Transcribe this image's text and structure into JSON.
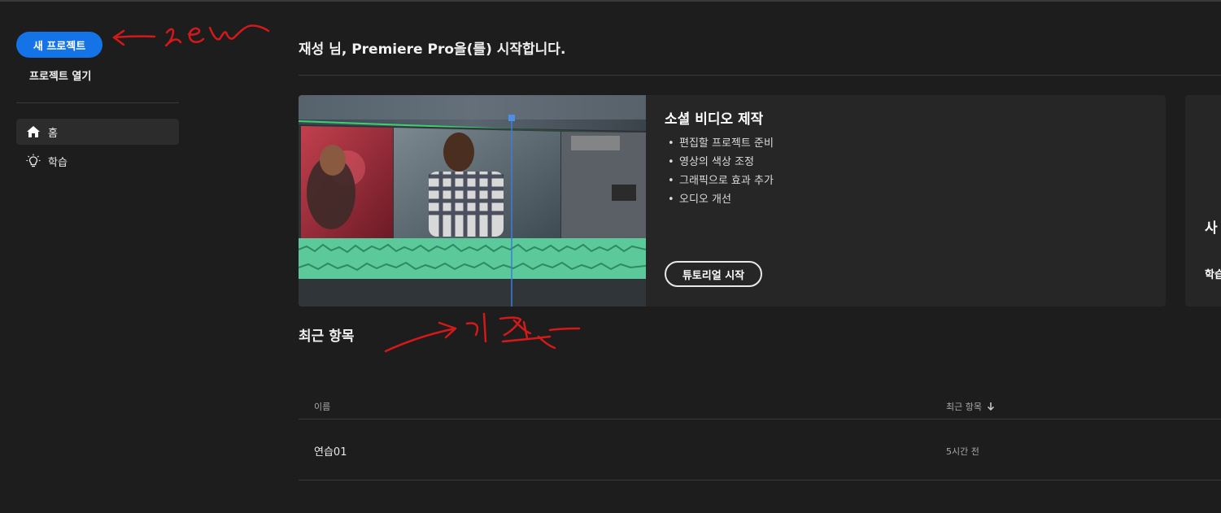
{
  "sidebar": {
    "new_project": "새 프로젝트",
    "open_project": "프로젝트 열기",
    "nav": [
      {
        "label": "홈",
        "icon": "home-icon",
        "active": true
      },
      {
        "label": "학습",
        "icon": "lightbulb-icon",
        "active": false
      }
    ]
  },
  "main": {
    "welcome": "재성 님, Premiere Pro을(를) 시작합니다.",
    "tutorial_card": {
      "title": "소셜 비디오 제작",
      "bullets": [
        "편집할 프로젝트 준비",
        "영상의 색상 조정",
        "그래픽으로 효과 추가",
        "오디오 개선"
      ],
      "button": "튜토리얼 시작"
    },
    "second_card": {
      "title_partial": "사",
      "link_partial": "학습"
    },
    "recent": {
      "title": "최근 항목",
      "columns": {
        "name": "이름",
        "recent": "최근 항목"
      },
      "rows": [
        {
          "name": "연습01",
          "time": "5시간 전"
        }
      ]
    }
  },
  "annotations": {
    "arrow_new_text": "new",
    "arrow_recent_text": "기존",
    "color": "#d31919"
  },
  "colors": {
    "accent": "#1473e6",
    "background": "#1d1d1d",
    "card": "#262626"
  }
}
